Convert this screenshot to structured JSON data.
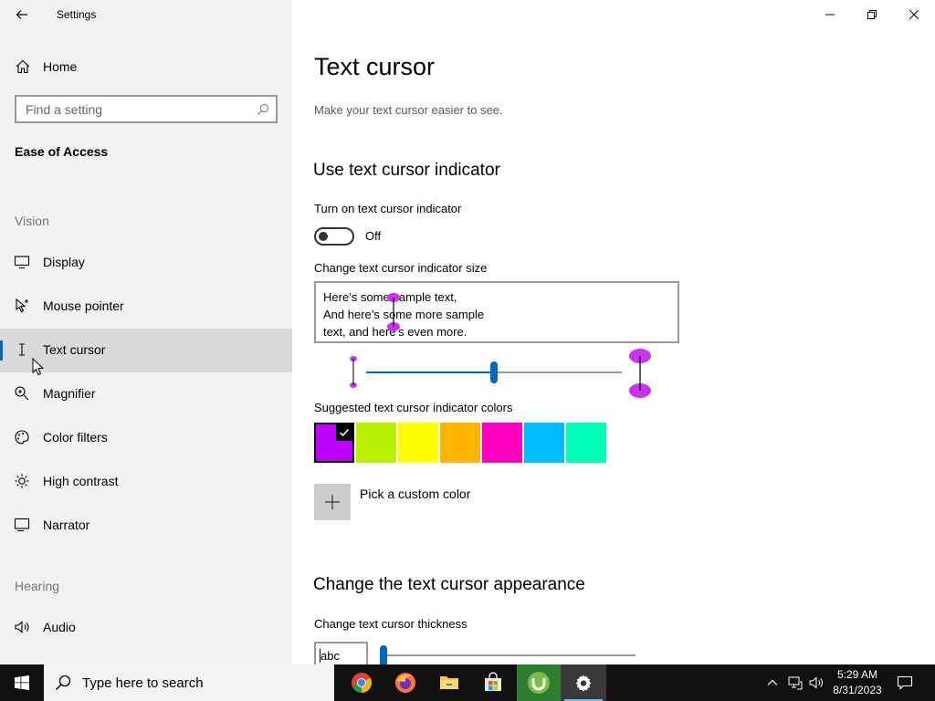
{
  "app": {
    "title": "Settings"
  },
  "sidebar": {
    "home_label": "Home",
    "search_placeholder": "Find a setting",
    "section_title": "Ease of Access",
    "groups": {
      "vision": "Vision",
      "hearing": "Hearing"
    },
    "items": [
      {
        "label": "Display",
        "icon": "monitor-icon"
      },
      {
        "label": "Mouse pointer",
        "icon": "mouse-pointer-icon"
      },
      {
        "label": "Text cursor",
        "icon": "text-cursor-icon",
        "selected": true
      },
      {
        "label": "Magnifier",
        "icon": "magnifier-icon"
      },
      {
        "label": "Color filters",
        "icon": "palette-icon"
      },
      {
        "label": "High contrast",
        "icon": "brightness-icon"
      },
      {
        "label": "Narrator",
        "icon": "narrator-icon"
      },
      {
        "label": "Audio",
        "icon": "speaker-icon"
      }
    ]
  },
  "main": {
    "title": "Text cursor",
    "description": "Make your text cursor easier to see.",
    "indicator_heading": "Use text cursor indicator",
    "toggle_label": "Turn on text cursor indicator",
    "toggle_state": "Off",
    "size_label": "Change text cursor indicator size",
    "preview_lines": [
      "Here’s some sample text,",
      "And here’s some more sample",
      "text, and here’s even more."
    ],
    "size_slider_value": 0.5,
    "colors_label": "Suggested text cursor indicator colors",
    "colors": [
      "#bf00ff",
      "#b8f200",
      "#ffff00",
      "#ffb400",
      "#ff00c3",
      "#00bfff",
      "#00ffb8"
    ],
    "selected_color_index": 0,
    "custom_color_label": "Pick a custom color",
    "appearance_heading": "Change the text cursor appearance",
    "thickness_label": "Change text cursor thickness",
    "thickness_sample": "abc",
    "thickness_slider_value": 0
  },
  "taskbar": {
    "search_placeholder": "Type here to search",
    "apps": [
      "chrome-icon",
      "firefox-icon",
      "file-explorer-icon",
      "store-icon",
      "utorrent-icon",
      "settings-icon"
    ],
    "time": "5:29 AM",
    "date": "8/31/2023"
  },
  "accent_color": "#0067c0"
}
